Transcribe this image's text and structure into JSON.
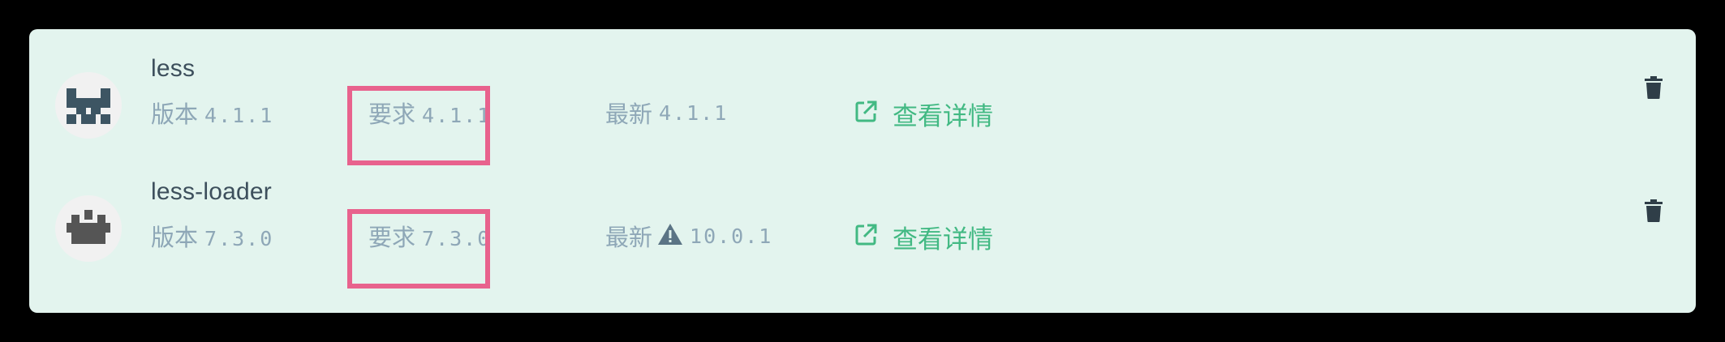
{
  "labels": {
    "version": "版本",
    "required": "要求",
    "latest": "最新",
    "details": "查看详情"
  },
  "dependencies": [
    {
      "name": "less",
      "version": "4.1.1",
      "required": "4.1.1",
      "latest": "4.1.1",
      "outdated": false,
      "avatar_icon": "identicon-less"
    },
    {
      "name": "less-loader",
      "version": "7.3.0",
      "required": "7.3.0",
      "latest": "10.0.1",
      "outdated": true,
      "avatar_icon": "identicon-less-loader"
    }
  ],
  "colors": {
    "panel_bg": "#e3f4ee",
    "accent": "#42b983",
    "highlight": "#e8628d",
    "muted": "#8ea7b7",
    "name": "#3d4f5c"
  }
}
